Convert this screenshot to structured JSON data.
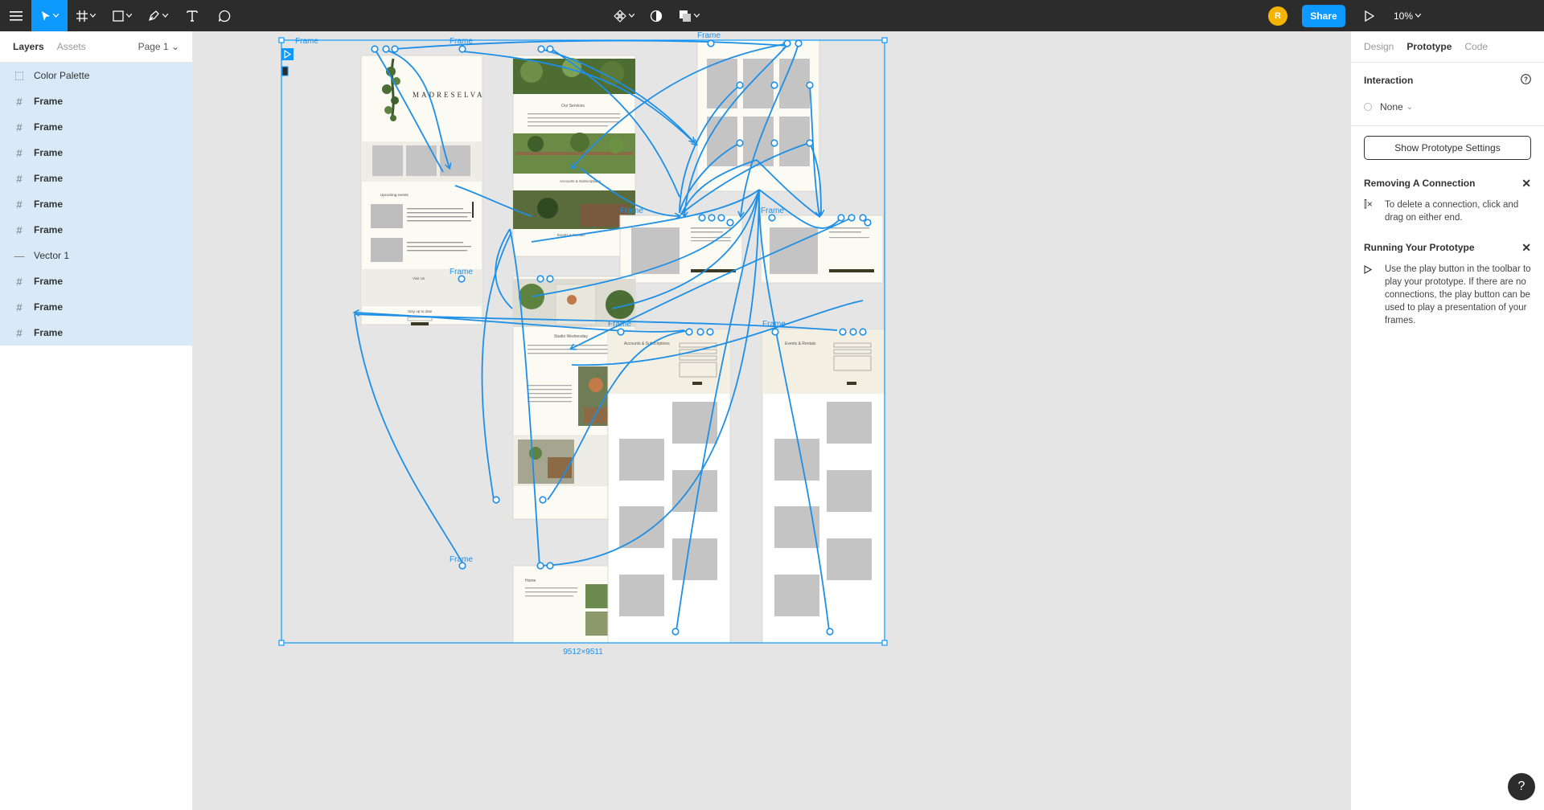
{
  "toolbar": {
    "avatar_initial": "R",
    "share_label": "Share",
    "zoom": "10%"
  },
  "left": {
    "tabs": [
      "Layers",
      "Assets"
    ],
    "page": "Page 1",
    "layers": [
      {
        "name": "Color Palette",
        "icon": "dashed-frame-icon"
      },
      {
        "name": "Frame",
        "icon": "frame-icon"
      },
      {
        "name": "Frame",
        "icon": "frame-icon"
      },
      {
        "name": "Frame",
        "icon": "frame-icon"
      },
      {
        "name": "Frame",
        "icon": "frame-icon"
      },
      {
        "name": "Frame",
        "icon": "frame-icon"
      },
      {
        "name": "Frame",
        "icon": "frame-icon"
      },
      {
        "name": "Vector 1",
        "icon": "line-icon"
      },
      {
        "name": "Frame",
        "icon": "frame-icon"
      },
      {
        "name": "Frame",
        "icon": "frame-icon"
      },
      {
        "name": "Frame",
        "icon": "frame-icon"
      }
    ]
  },
  "right": {
    "tabs": [
      "Design",
      "Prototype",
      "Code"
    ],
    "interaction_label": "Interaction",
    "interaction_value": "None",
    "settings_button": "Show Prototype Settings",
    "removing_title": "Removing A Connection",
    "removing_text": "To delete a connection, click and drag on either end.",
    "running_title": "Running Your Prototype",
    "running_text": "Use the play button in the toolbar to play your prototype. If there are no connections, the play button can be used to play a presentation of your frames."
  },
  "canvas": {
    "frame_label": "Frame",
    "selection_size": "9512×9511",
    "home": {
      "brand": "MADRESELVA",
      "upcoming": "Upcoming events",
      "visit": "Visit Us",
      "signup": "Stay up to date"
    },
    "services": {
      "heading": "Our Services",
      "link1": "Accounts & Subscriptions",
      "link2": "Events & Rentals"
    },
    "studio": {
      "heading": "Studio Wednesday"
    },
    "homepage": {
      "heading": "Home"
    },
    "accounts": {
      "heading": "Accounts & Subscriptions"
    },
    "events": {
      "heading": "Events & Rentals"
    }
  },
  "colors": {
    "accent": "#0d99ff",
    "connector": "#1e8fe6",
    "toolbar": "#2c2c2c",
    "avatar": "#f5b400",
    "layer_selected": "#d9e9f8"
  }
}
